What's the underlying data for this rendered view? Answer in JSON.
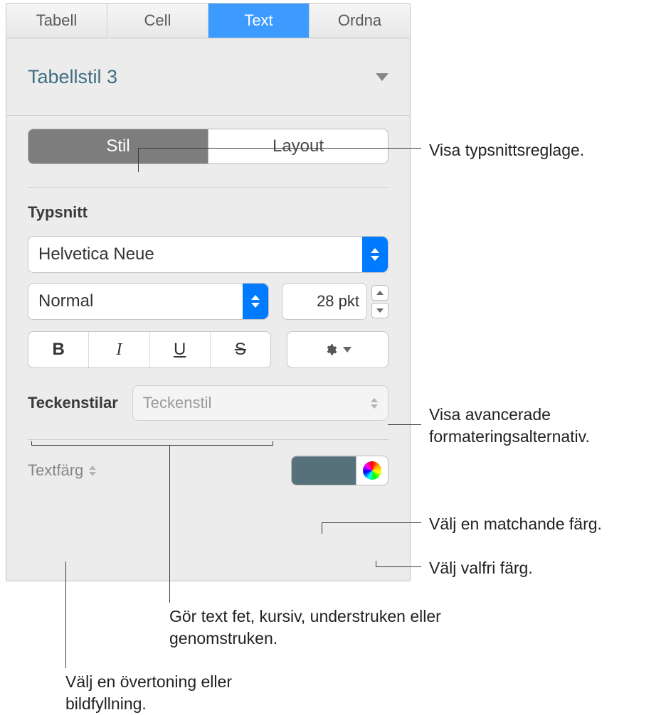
{
  "tabs": {
    "tabell": "Tabell",
    "cell": "Cell",
    "text": "Text",
    "ordna": "Ordna"
  },
  "style_title": "Tabellstil 3",
  "segmented": {
    "stil": "Stil",
    "layout": "Layout"
  },
  "font_section": {
    "label": "Typsnitt",
    "family": "Helvetica Neue",
    "weight": "Normal",
    "size": "28 pkt",
    "bius": {
      "b": "B",
      "i": "I",
      "u": "U",
      "s": "S"
    }
  },
  "char_styles": {
    "label": "Teckenstilar",
    "placeholder": "Teckenstil"
  },
  "text_color": {
    "label": "Textfärg",
    "swatch_hex": "#56717a"
  },
  "callouts": {
    "c1": "Visa typsnittsreglage.",
    "c2": "Visa avancerade formateringsalternativ.",
    "c3": "Välj en matchande färg.",
    "c4": "Välj valfri färg.",
    "c5": "Gör text fet, kursiv, understruken eller genomstruken.",
    "c6": "Välj en övertoning eller bildfyllning."
  }
}
